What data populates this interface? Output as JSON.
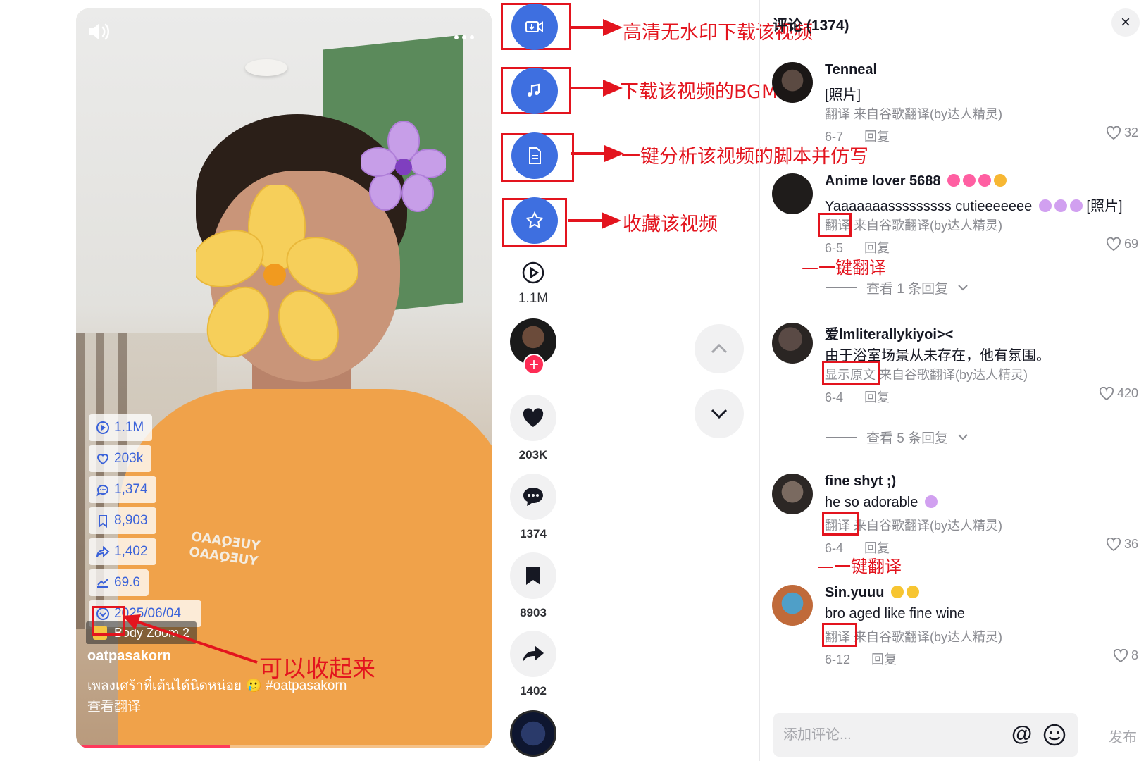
{
  "video": {
    "volume_icon": "speaker-icon",
    "more_icon": "more-dots-icon",
    "shirt_print": "YUEQAAO",
    "stats": [
      {
        "icon": "play-icon",
        "value": "1.1M"
      },
      {
        "icon": "heart-icon",
        "value": "203k"
      },
      {
        "icon": "comment-icon",
        "value": "1,374"
      },
      {
        "icon": "bookmark-icon",
        "value": "8,903"
      },
      {
        "icon": "share-icon",
        "value": "1,402"
      },
      {
        "icon": "trend-icon",
        "value": "69.6"
      }
    ],
    "date": "2025/06/04",
    "music": "Body Zoom  2",
    "author": "oatpasakorn",
    "caption": "เพลงเศร้าที่เต้นได้นิดหน่อย 🥲  #oatpasakorn",
    "caption_translate": "查看翻译",
    "progress": 0.37
  },
  "tools": {
    "download_video": "高清无水印下载该视频",
    "download_bgm": "下载该视频的BGM",
    "analyze_script": "一键分析该视频的脚本并仿写",
    "favorite": "收藏该视频",
    "collapse_hint": "可以收起来"
  },
  "actions": {
    "plays": "1.1M",
    "likes": "203K",
    "comments": "1374",
    "saves": "8903",
    "shares": "1402"
  },
  "comments_panel": {
    "title": "评论 (1374)",
    "close": "×",
    "one_click_translate": "一键翻译",
    "items": [
      {
        "name": "Tenneal",
        "text": "[照片]",
        "tr_label": "翻译",
        "tr_source": "来自谷歌翻译(by达人精灵)",
        "date": "6-7",
        "reply": "回复",
        "likes": "32"
      },
      {
        "name": "Anime lover 5688",
        "text": "Yaaaaaaasssssssss cutieeeeeee",
        "text_suffix": "[照片]",
        "tr_label": "翻译",
        "tr_source": "来自谷歌翻译(by达人精灵)",
        "date": "6-5",
        "reply": "回复",
        "likes": "69"
      },
      {
        "name": "爱lmliterallykiyoi><",
        "text": "由于浴室场景从未存在，他有氛围。",
        "tr_label": "显示原文",
        "tr_source": "来自谷歌翻译(by达人精灵)",
        "date": "6-4",
        "reply": "回复",
        "likes": "420"
      },
      {
        "name": "fine shyt ;)",
        "text": "he so adorable",
        "tr_label": "翻译",
        "tr_source": "来自谷歌翻译(by达人精灵)",
        "date": "6-4",
        "reply": "回复",
        "likes": "36"
      },
      {
        "name": "Sin.yuuu",
        "text": "bro aged like fine wine",
        "tr_label": "翻译",
        "tr_source": "来自谷歌翻译(by达人精灵)",
        "date": "6-12",
        "reply": "回复",
        "likes": "8"
      }
    ],
    "view_replies_1": "查看 1 条回复",
    "view_replies_5": "查看 5 条回复",
    "input_placeholder": "添加评论...",
    "at": "@",
    "post": "发布"
  },
  "colors": {
    "accent_blue": "#3e6fe0",
    "annotation_red": "#e3141e",
    "tiktok_pink": "#fe2c55"
  }
}
